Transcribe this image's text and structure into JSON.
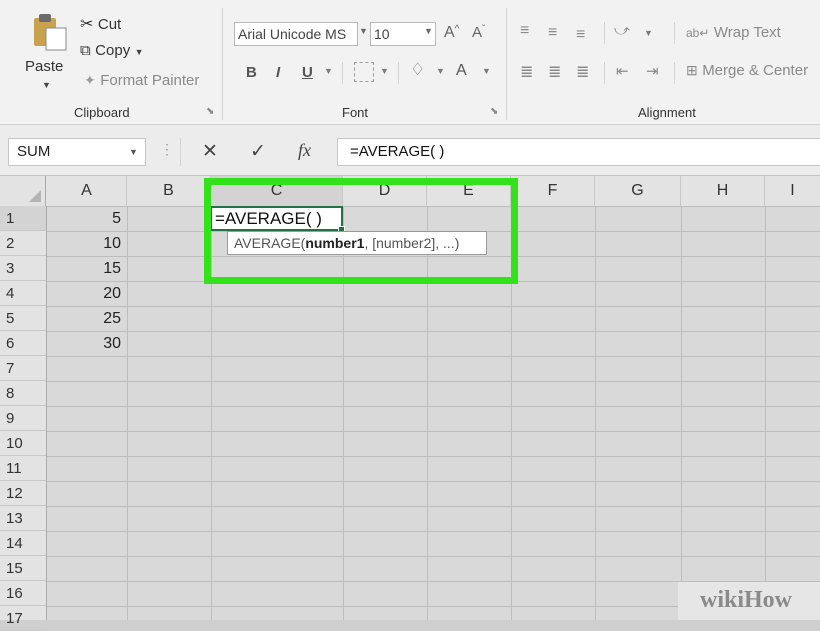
{
  "ribbon": {
    "clipboard": {
      "paste_label": "Paste",
      "cut_label": "Cut",
      "copy_label": "Copy",
      "format_painter_label": "Format Painter",
      "group_label": "Clipboard"
    },
    "font": {
      "font_name": "Arial Unicode MS",
      "font_size": "10",
      "group_label": "Font",
      "bold": "B",
      "italic": "I",
      "underline": "U",
      "grow": "A",
      "shrink": "A",
      "color": "A"
    },
    "alignment": {
      "wrap_text_label": "Wrap Text",
      "merge_label": "Merge & Center",
      "group_label": "Alignment"
    }
  },
  "formula_bar": {
    "name_box": "SUM",
    "cancel_glyph": "✕",
    "enter_glyph": "✓",
    "fx_glyph": "fx",
    "formula": "=AVERAGE( )"
  },
  "columns": [
    "A",
    "B",
    "C",
    "D",
    "E",
    "F",
    "G",
    "H",
    "I"
  ],
  "rows": [
    "1",
    "2",
    "3",
    "4",
    "5",
    "6",
    "7",
    "8",
    "9",
    "10",
    "11",
    "12",
    "13",
    "14",
    "15",
    "16",
    "17"
  ],
  "column_a_values": [
    "5",
    "10",
    "15",
    "20",
    "25",
    "30"
  ],
  "active_cell": {
    "content": "=AVERAGE( )",
    "tooltip_func": "AVERAGE(",
    "tooltip_arg": "number1",
    "tooltip_rest": ", [number2], ...)"
  },
  "watermark": "wikiHow",
  "colors": {
    "highlight": "#34e21c",
    "active_border": "#217346"
  }
}
